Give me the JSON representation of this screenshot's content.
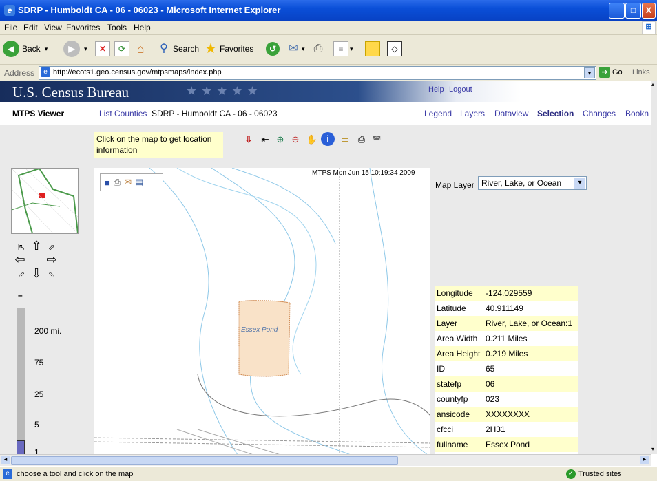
{
  "window": {
    "title": "SDRP - Humboldt CA - 06 - 06023 - Microsoft Internet Explorer",
    "min": "_",
    "max": "□",
    "close": "X"
  },
  "menu": [
    "File",
    "Edit",
    "View",
    "Favorites",
    "Tools",
    "Help"
  ],
  "toolbar": {
    "back": "Back",
    "search": "Search",
    "favorites": "Favorites"
  },
  "address": {
    "label": "Address",
    "url": "http://ecots1.geo.census.gov/mtpsmaps/index.php",
    "go": "Go",
    "links": "Links"
  },
  "banner": {
    "agency": "U.S. Census Bureau",
    "help": "Help",
    "logout": "Logout"
  },
  "nav": {
    "viewer": "MTPS Viewer",
    "list_counties": "List Counties",
    "location": "SDRP - Humboldt CA - 06 - 06023",
    "tabs": [
      "Legend",
      "Layers",
      "Dataview",
      "Selection",
      "Changes",
      "Bookn"
    ]
  },
  "hint": "Click on the map to get location information",
  "map": {
    "timestamp": "MTPS Mon Jun 15 10:19:34 2009",
    "feature_label": "Essex Pond"
  },
  "zoom": {
    "minus": "–",
    "levels": [
      "200 mi.",
      "75",
      "25",
      "5",
      "1"
    ]
  },
  "map_layer": {
    "label": "Map Layer",
    "value": "River, Lake, or Ocean"
  },
  "info": [
    {
      "k": "Longitude",
      "v": "-124.029559"
    },
    {
      "k": "Latitude",
      "v": "40.911149"
    },
    {
      "k": "Layer",
      "v": "River, Lake, or Ocean:1"
    },
    {
      "k": "Area Width",
      "v": "0.211 Miles"
    },
    {
      "k": "Area Height",
      "v": "0.219 Miles"
    },
    {
      "k": "ID",
      "v": "65"
    },
    {
      "k": "statefp",
      "v": "06"
    },
    {
      "k": "countyfp",
      "v": "023"
    },
    {
      "k": "ansicode",
      "v": "XXXXXXXX"
    },
    {
      "k": "cfcci",
      "v": "2H31"
    },
    {
      "k": "fullname",
      "v": "Essex Pond"
    },
    {
      "k": "chng_type",
      "v": "–"
    }
  ],
  "status": {
    "message": "choose a tool and click on the map",
    "zone": "Trusted sites"
  }
}
